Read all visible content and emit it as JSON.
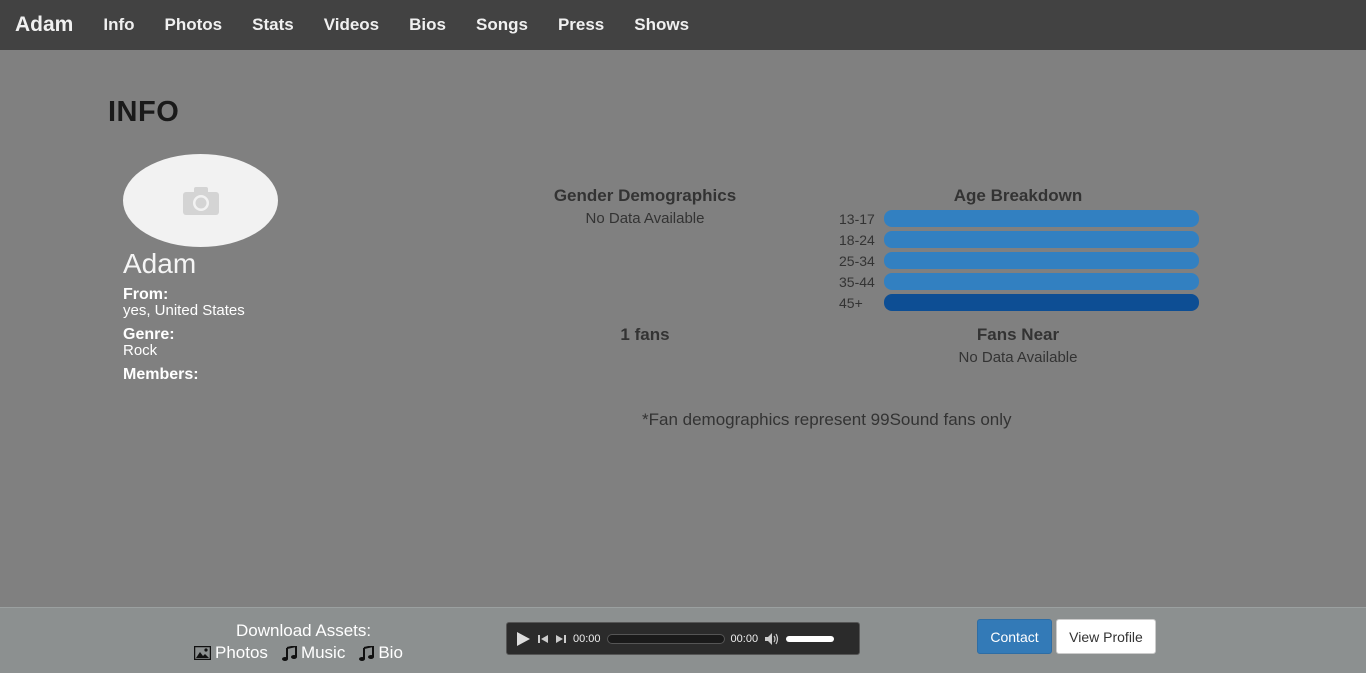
{
  "nav": {
    "brand": "Adam",
    "items": [
      "Info",
      "Photos",
      "Stats",
      "Videos",
      "Bios",
      "Songs",
      "Press",
      "Shows"
    ]
  },
  "page": {
    "title": "INFO"
  },
  "profile": {
    "name": "Adam",
    "from_label": "From:",
    "from_value": "yes, United States",
    "genre_label": "Genre:",
    "genre_value": "Rock",
    "members_label": "Members:"
  },
  "gender": {
    "title": "Gender Demographics",
    "note": "No Data Available"
  },
  "age": {
    "title": "Age Breakdown",
    "rows": [
      {
        "label": "13-17",
        "color": "#3280c1"
      },
      {
        "label": "18-24",
        "color": "#3280c1"
      },
      {
        "label": "25-34",
        "color": "#3280c1"
      },
      {
        "label": "35-44",
        "color": "#3280c1"
      },
      {
        "label": "45+",
        "color": "#0d4e94"
      }
    ]
  },
  "fans": {
    "count_text": "1  fans"
  },
  "fans_near": {
    "title": "Fans Near",
    "note": "No Data Available"
  },
  "disclaimer": "*Fan demographics represent 99Sound fans only",
  "footer": {
    "download_title": "Download Assets:",
    "links": [
      {
        "label": "Photos",
        "icon": "image-icon"
      },
      {
        "label": "Music",
        "icon": "music-icon"
      },
      {
        "label": "Bio",
        "icon": "music-icon"
      }
    ],
    "player": {
      "current_time": "00:00",
      "duration": "00:00"
    },
    "contact_label": "Contact",
    "view_profile_label": "View Profile"
  }
}
